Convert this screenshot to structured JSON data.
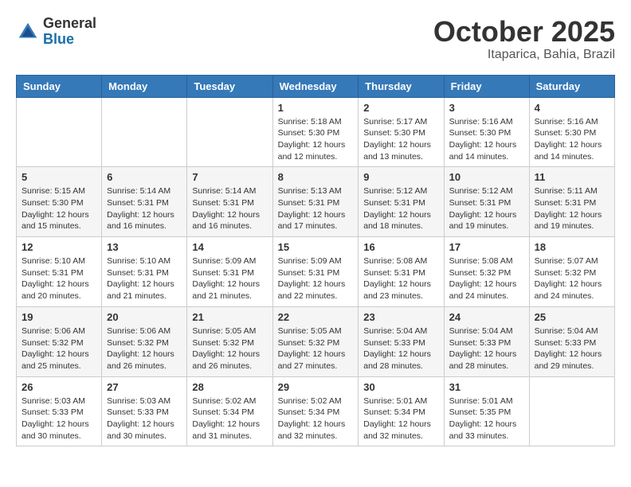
{
  "header": {
    "logo": {
      "general": "General",
      "blue": "Blue"
    },
    "title": "October 2025",
    "subtitle": "Itaparica, Bahia, Brazil"
  },
  "weekdays": [
    "Sunday",
    "Monday",
    "Tuesday",
    "Wednesday",
    "Thursday",
    "Friday",
    "Saturday"
  ],
  "weeks": [
    [
      {
        "day": "",
        "info": ""
      },
      {
        "day": "",
        "info": ""
      },
      {
        "day": "",
        "info": ""
      },
      {
        "day": "1",
        "info": "Sunrise: 5:18 AM\nSunset: 5:30 PM\nDaylight: 12 hours\nand 12 minutes."
      },
      {
        "day": "2",
        "info": "Sunrise: 5:17 AM\nSunset: 5:30 PM\nDaylight: 12 hours\nand 13 minutes."
      },
      {
        "day": "3",
        "info": "Sunrise: 5:16 AM\nSunset: 5:30 PM\nDaylight: 12 hours\nand 14 minutes."
      },
      {
        "day": "4",
        "info": "Sunrise: 5:16 AM\nSunset: 5:30 PM\nDaylight: 12 hours\nand 14 minutes."
      }
    ],
    [
      {
        "day": "5",
        "info": "Sunrise: 5:15 AM\nSunset: 5:30 PM\nDaylight: 12 hours\nand 15 minutes."
      },
      {
        "day": "6",
        "info": "Sunrise: 5:14 AM\nSunset: 5:31 PM\nDaylight: 12 hours\nand 16 minutes."
      },
      {
        "day": "7",
        "info": "Sunrise: 5:14 AM\nSunset: 5:31 PM\nDaylight: 12 hours\nand 16 minutes."
      },
      {
        "day": "8",
        "info": "Sunrise: 5:13 AM\nSunset: 5:31 PM\nDaylight: 12 hours\nand 17 minutes."
      },
      {
        "day": "9",
        "info": "Sunrise: 5:12 AM\nSunset: 5:31 PM\nDaylight: 12 hours\nand 18 minutes."
      },
      {
        "day": "10",
        "info": "Sunrise: 5:12 AM\nSunset: 5:31 PM\nDaylight: 12 hours\nand 19 minutes."
      },
      {
        "day": "11",
        "info": "Sunrise: 5:11 AM\nSunset: 5:31 PM\nDaylight: 12 hours\nand 19 minutes."
      }
    ],
    [
      {
        "day": "12",
        "info": "Sunrise: 5:10 AM\nSunset: 5:31 PM\nDaylight: 12 hours\nand 20 minutes."
      },
      {
        "day": "13",
        "info": "Sunrise: 5:10 AM\nSunset: 5:31 PM\nDaylight: 12 hours\nand 21 minutes."
      },
      {
        "day": "14",
        "info": "Sunrise: 5:09 AM\nSunset: 5:31 PM\nDaylight: 12 hours\nand 21 minutes."
      },
      {
        "day": "15",
        "info": "Sunrise: 5:09 AM\nSunset: 5:31 PM\nDaylight: 12 hours\nand 22 minutes."
      },
      {
        "day": "16",
        "info": "Sunrise: 5:08 AM\nSunset: 5:31 PM\nDaylight: 12 hours\nand 23 minutes."
      },
      {
        "day": "17",
        "info": "Sunrise: 5:08 AM\nSunset: 5:32 PM\nDaylight: 12 hours\nand 24 minutes."
      },
      {
        "day": "18",
        "info": "Sunrise: 5:07 AM\nSunset: 5:32 PM\nDaylight: 12 hours\nand 24 minutes."
      }
    ],
    [
      {
        "day": "19",
        "info": "Sunrise: 5:06 AM\nSunset: 5:32 PM\nDaylight: 12 hours\nand 25 minutes."
      },
      {
        "day": "20",
        "info": "Sunrise: 5:06 AM\nSunset: 5:32 PM\nDaylight: 12 hours\nand 26 minutes."
      },
      {
        "day": "21",
        "info": "Sunrise: 5:05 AM\nSunset: 5:32 PM\nDaylight: 12 hours\nand 26 minutes."
      },
      {
        "day": "22",
        "info": "Sunrise: 5:05 AM\nSunset: 5:32 PM\nDaylight: 12 hours\nand 27 minutes."
      },
      {
        "day": "23",
        "info": "Sunrise: 5:04 AM\nSunset: 5:33 PM\nDaylight: 12 hours\nand 28 minutes."
      },
      {
        "day": "24",
        "info": "Sunrise: 5:04 AM\nSunset: 5:33 PM\nDaylight: 12 hours\nand 28 minutes."
      },
      {
        "day": "25",
        "info": "Sunrise: 5:04 AM\nSunset: 5:33 PM\nDaylight: 12 hours\nand 29 minutes."
      }
    ],
    [
      {
        "day": "26",
        "info": "Sunrise: 5:03 AM\nSunset: 5:33 PM\nDaylight: 12 hours\nand 30 minutes."
      },
      {
        "day": "27",
        "info": "Sunrise: 5:03 AM\nSunset: 5:33 PM\nDaylight: 12 hours\nand 30 minutes."
      },
      {
        "day": "28",
        "info": "Sunrise: 5:02 AM\nSunset: 5:34 PM\nDaylight: 12 hours\nand 31 minutes."
      },
      {
        "day": "29",
        "info": "Sunrise: 5:02 AM\nSunset: 5:34 PM\nDaylight: 12 hours\nand 32 minutes."
      },
      {
        "day": "30",
        "info": "Sunrise: 5:01 AM\nSunset: 5:34 PM\nDaylight: 12 hours\nand 32 minutes."
      },
      {
        "day": "31",
        "info": "Sunrise: 5:01 AM\nSunset: 5:35 PM\nDaylight: 12 hours\nand 33 minutes."
      },
      {
        "day": "",
        "info": ""
      }
    ]
  ]
}
